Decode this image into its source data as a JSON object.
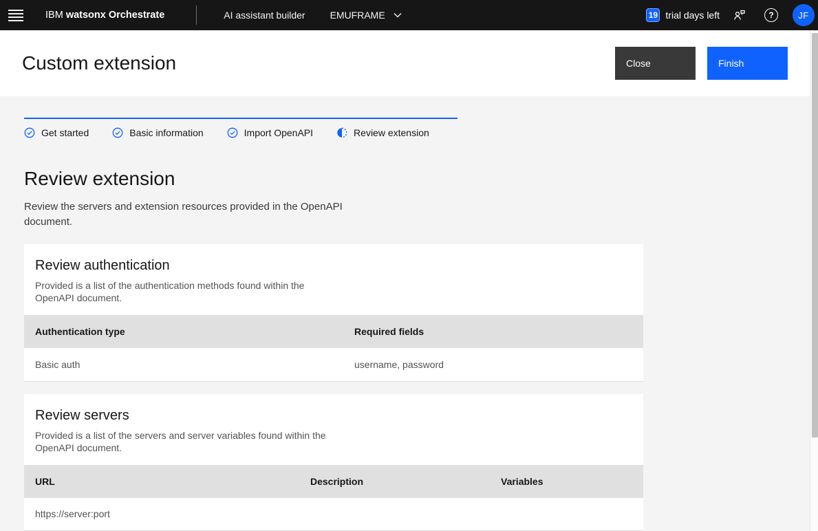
{
  "header": {
    "brand_prefix": "IBM",
    "brand_name": "watsonx Orchestrate",
    "nav_app": "AI assistant builder",
    "environment": "EMUFRAME",
    "trial_days": "19",
    "trial_label": "trial days left",
    "avatar_initials": "JF"
  },
  "icons": {
    "help_glyph": "?"
  },
  "title_bar": {
    "title": "Custom extension",
    "close_label": "Close",
    "finish_label": "Finish"
  },
  "progress": {
    "steps": [
      {
        "label": "Get started",
        "state": "complete"
      },
      {
        "label": "Basic information",
        "state": "complete"
      },
      {
        "label": "Import OpenAPI",
        "state": "complete"
      },
      {
        "label": "Review extension",
        "state": "current"
      }
    ]
  },
  "main": {
    "heading": "Review extension",
    "description": "Review the servers and extension resources provided in the OpenAPI document.",
    "auth_section": {
      "heading": "Review authentication",
      "description": "Provided is a list of the authentication methods found within the OpenAPI document.",
      "table": {
        "columns": [
          "Authentication type",
          "Required fields"
        ],
        "rows": [
          [
            "Basic auth",
            "username, password"
          ]
        ]
      }
    },
    "servers_section": {
      "heading": "Review servers",
      "description": "Provided is a list of the servers and server variables found within the OpenAPI document.",
      "table": {
        "columns": [
          "URL",
          "Description",
          "Variables"
        ],
        "rows": [
          [
            "https://server:port",
            "",
            ""
          ]
        ]
      }
    }
  },
  "colors": {
    "accent": "#0f62fe",
    "header_bg": "#161616",
    "close_button_bg": "#393939",
    "table_header_bg": "#e0e0e0",
    "page_bg": "#f4f4f4"
  }
}
